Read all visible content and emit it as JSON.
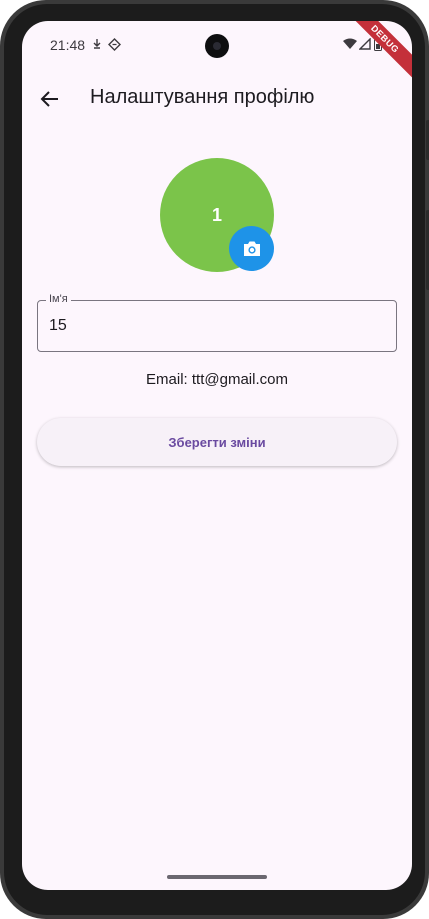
{
  "status_bar": {
    "time": "21:48",
    "icons": [
      "download-icon",
      "sync-icon",
      "wifi-icon",
      "signal-icon",
      "battery-icon"
    ],
    "debug_label": "DEBUG"
  },
  "app_bar": {
    "title": "Налаштування профілю",
    "back_icon": "arrow-back-icon"
  },
  "profile": {
    "avatar_initial": "1",
    "avatar_color": "#7bc44a",
    "camera_button_color": "#1e93e8"
  },
  "name_field": {
    "label": "Ім'я",
    "value": "15"
  },
  "email_text": "Email: ttt@gmail.com",
  "save_button": {
    "label": "Зберегти зміни",
    "text_color": "#6a4aa0"
  }
}
